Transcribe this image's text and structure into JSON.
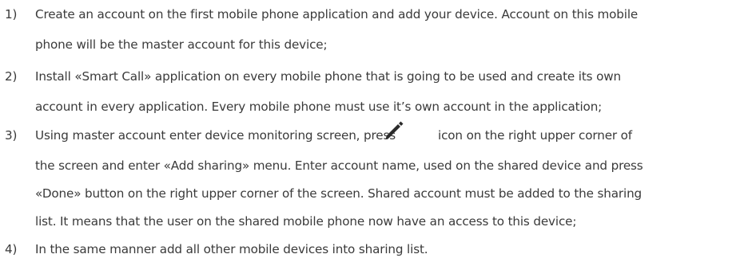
{
  "steps": [
    {
      "number": "1)",
      "lines": [
        "Create an account on the first mobile phone application and add your device. Account on this mobile",
        "phone will be the master account for this device;"
      ]
    },
    {
      "number": "2)",
      "lines": [
        "Install «Smart Call» application on every mobile phone that is going to be used and create its own",
        "account in every application. Every mobile phone must use it’s own account in the application;"
      ]
    },
    {
      "number": "3)",
      "lines": [
        "Using master account enter device monitoring screen, press",
        "icon on the right upper corner of",
        "the screen and enter «Add sharing» menu. Enter account name, used on the shared device and press",
        "«Done» button on the right upper corner of the screen. Shared account must be added to the sharing",
        "list. It means that the user on the shared mobile phone now have an access to this device;"
      ],
      "icon": "pencil-edit-icon"
    },
    {
      "number": "4)",
      "lines": [
        "In the same manner add all other mobile devices into sharing list."
      ]
    }
  ],
  "colors": {
    "text": "#3a3a3a",
    "icon": "#2b2b2b"
  }
}
